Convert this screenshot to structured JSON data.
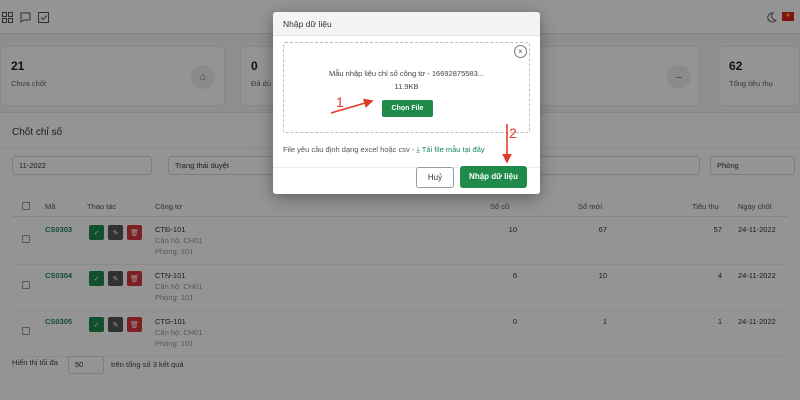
{
  "stats": [
    {
      "value": "21",
      "label": "Chưa chốt"
    },
    {
      "value": "0",
      "label": "Đã dù"
    },
    {
      "value": "62",
      "label": "Tổng tiêu thụ"
    }
  ],
  "panel": {
    "title": "Chốt chỉ số",
    "month_value": "11-2022",
    "status_placeholder": "Trạng thái duyệt",
    "room_placeholder": "Phòng"
  },
  "table": {
    "headers": {
      "code": "Mã",
      "actions": "Thao tác",
      "meter": "Công tơ",
      "old": "Số cũ",
      "new": "Số mới",
      "consumption": "Tiêu thụ",
      "date": "Ngày chốt"
    },
    "rows": [
      {
        "code": "CS0303",
        "meter": "CTĐ-101",
        "apartment": "Căn hộ: CH01",
        "room": "Phòng: 101",
        "old": "10",
        "new": "67",
        "consumption": "57",
        "date": "24-11-2022"
      },
      {
        "code": "CS0304",
        "meter": "CTN-101",
        "apartment": "Căn hộ: CH01",
        "room": "Phòng: 101",
        "old": "6",
        "new": "10",
        "consumption": "4",
        "date": "24-11-2022"
      },
      {
        "code": "CS0305",
        "meter": "CTG-101",
        "apartment": "Căn hộ: CH01",
        "room": "Phòng: 101",
        "old": "0",
        "new": "1",
        "consumption": "1",
        "date": "24-11-2022"
      }
    ]
  },
  "footer": {
    "show_label": "Hiển thị tối đa",
    "page_size": "50",
    "total_label": "trên tổng số 3 kết quả"
  },
  "modal": {
    "title": "Nhập dữ liệu",
    "file_name": "Mẫu nhập liệu chỉ số công tơ - 16692875583...",
    "file_size": "11.9KB",
    "choose_label": "Chọn File",
    "hint": "File yêu cầu định dạng excel hoặc csv -",
    "template_link": "Tải file mẫu tại đây",
    "cancel_label": "Huỷ",
    "submit_label": "Nhập dữ liệu"
  },
  "annotations": {
    "step1": "1",
    "step2": "2"
  },
  "colors": {
    "primary": "#1f8a49",
    "danger": "#d9363e",
    "annotation": "#e03a2a"
  }
}
